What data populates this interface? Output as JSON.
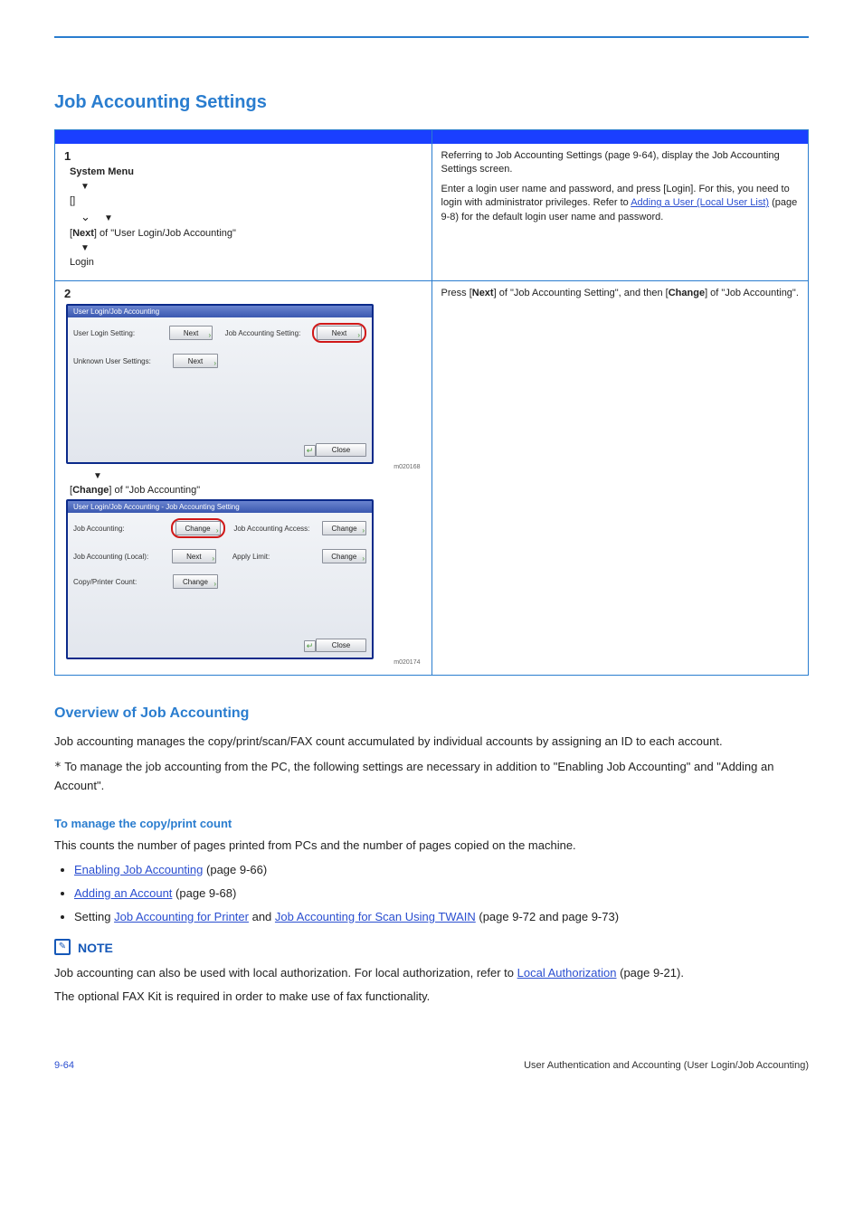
{
  "heading": "Job Accounting Settings",
  "step1": {
    "num": "1",
    "flow": {
      "0": "System Menu",
      "1": "",
      "2": "Next",
      "2suffix": "of \"User Login/Job Accounting\"",
      "3": "Login"
    },
    "right": {
      "0": "Referring to Job Accounting Settings (page 9-64), display the Job Accounting Settings screen.",
      "1a": "Enter a login user name and password, and press [Login]. For this, you need to login with administrator privileges. Refer to ",
      "link": "Adding a User (Local User List)",
      "1b": " (page 9-8) for the default login user name and password."
    }
  },
  "step2": {
    "num": "2",
    "mid": "Change",
    "midSuffix": "of \"Job Accounting\"",
    "right": {
      "0a": "Press ",
      "nextBold": "Next",
      "0b": " of \"Job Accounting Setting\", and then ",
      "changeBold": "Change",
      "0c": " of \"Job Accounting\"."
    }
  },
  "uiA": {
    "title": "User Login/Job Accounting",
    "rows": [
      {
        "label": "User Login Setting:",
        "btn": "Next"
      },
      {
        "label": "Job Accounting Setting:",
        "btn": "Next"
      },
      {
        "label": "Unknown User Settings:",
        "btn": "Next"
      }
    ],
    "close": "Close",
    "code": "m020168"
  },
  "uiB": {
    "title": "User Login/Job Accounting - Job Accounting Setting",
    "rows": [
      {
        "label": "Job Accounting:",
        "btn": "Change"
      },
      {
        "label": "Job Accounting Access:",
        "btn": "Change"
      },
      {
        "label": "Job Accounting (Local):",
        "btn": "Next"
      },
      {
        "label": "Apply Limit:",
        "btn": "Change"
      },
      {
        "label": "Copy/Printer Count:",
        "btn": "Change"
      }
    ],
    "close": "Close",
    "code": "m020174"
  },
  "overview": {
    "title": "Overview of Job Accounting",
    "p1": "Job accounting manages the copy/print/scan/FAX count accumulated by individual accounts by assigning an ID to each account.",
    "note": "To manage the job accounting from the PC, the following settings are necessary in addition to \"Enabling Job Accounting\" and \"Adding an Account\"."
  },
  "manage": {
    "title": "To manage the copy/print count",
    "p": "This counts the number of pages printed from PCs and the number of pages copied on the machine.",
    "items": [
      {
        "link": "Enabling Job Accounting",
        "page": "page 9-66"
      },
      {
        "link": "Adding an Account",
        "page": "page 9-68"
      },
      {
        "prefix": "Setting",
        "link1": "Job Accounting for Printer",
        "mid": "and",
        "link2": "Job Accounting for Scan Using TWAIN",
        "end": "(page 9-72 and page 9-73)"
      }
    ]
  },
  "note": {
    "label": "NOTE",
    "p1a": "Job accounting can also be used with local authorization. For local authorization, refer to ",
    "link": "Local Authorization",
    "p1b": " (page 9-21).",
    "p2": "The optional FAX Kit is required in order to make use of fax functionality."
  },
  "footer": {
    "page": "9-64",
    "title": "User Authentication and Accounting (User Login/Job Accounting)"
  }
}
